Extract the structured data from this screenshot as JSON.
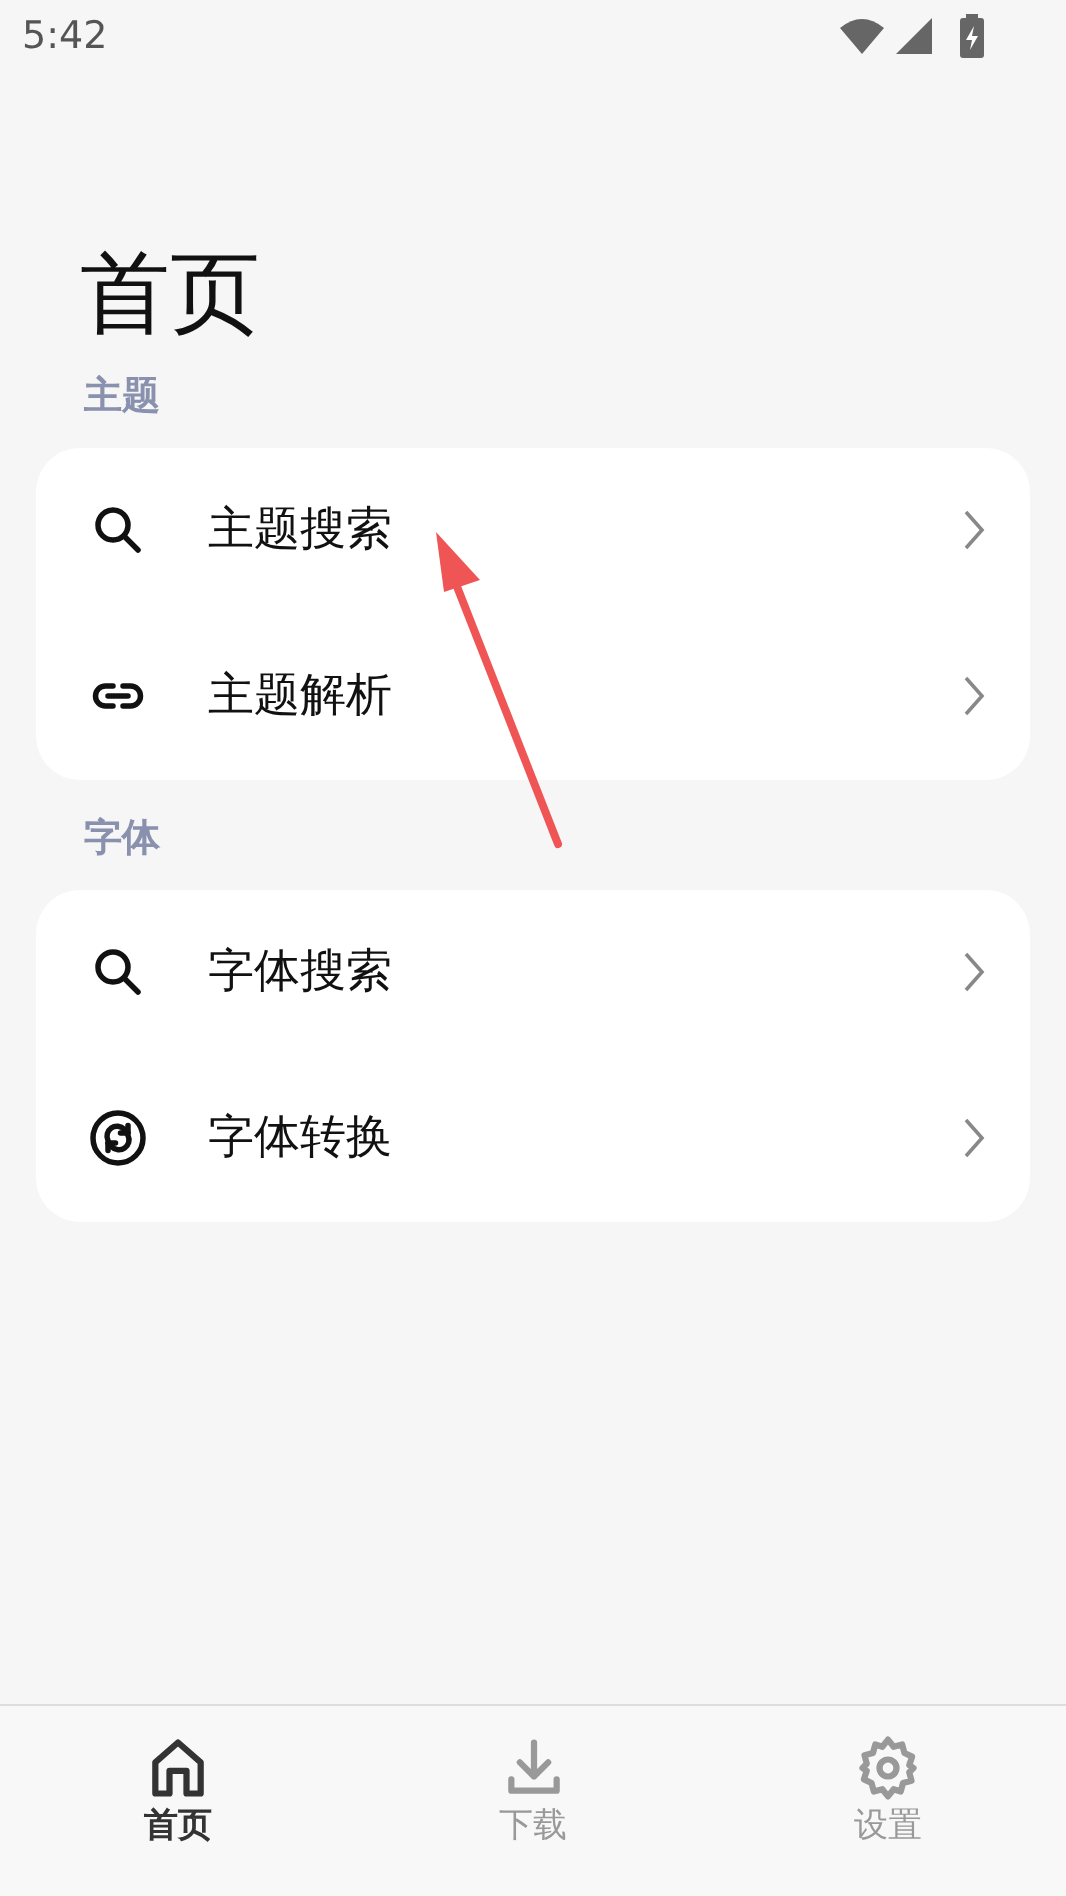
{
  "status_bar": {
    "time": "5:42"
  },
  "page_title": "首页",
  "sections": [
    {
      "title": "主题",
      "items": [
        {
          "kind": "search",
          "label": "主题搜索"
        },
        {
          "kind": "link",
          "label": "主题解析"
        }
      ]
    },
    {
      "title": "字体",
      "items": [
        {
          "kind": "search",
          "label": "字体搜索"
        },
        {
          "kind": "sync",
          "label": "字体转换"
        }
      ]
    }
  ],
  "bottom_nav": [
    {
      "kind": "home",
      "label": "首页",
      "selected": true
    },
    {
      "kind": "download",
      "label": "下载",
      "selected": false
    },
    {
      "kind": "settings",
      "label": "设置",
      "selected": false
    }
  ]
}
